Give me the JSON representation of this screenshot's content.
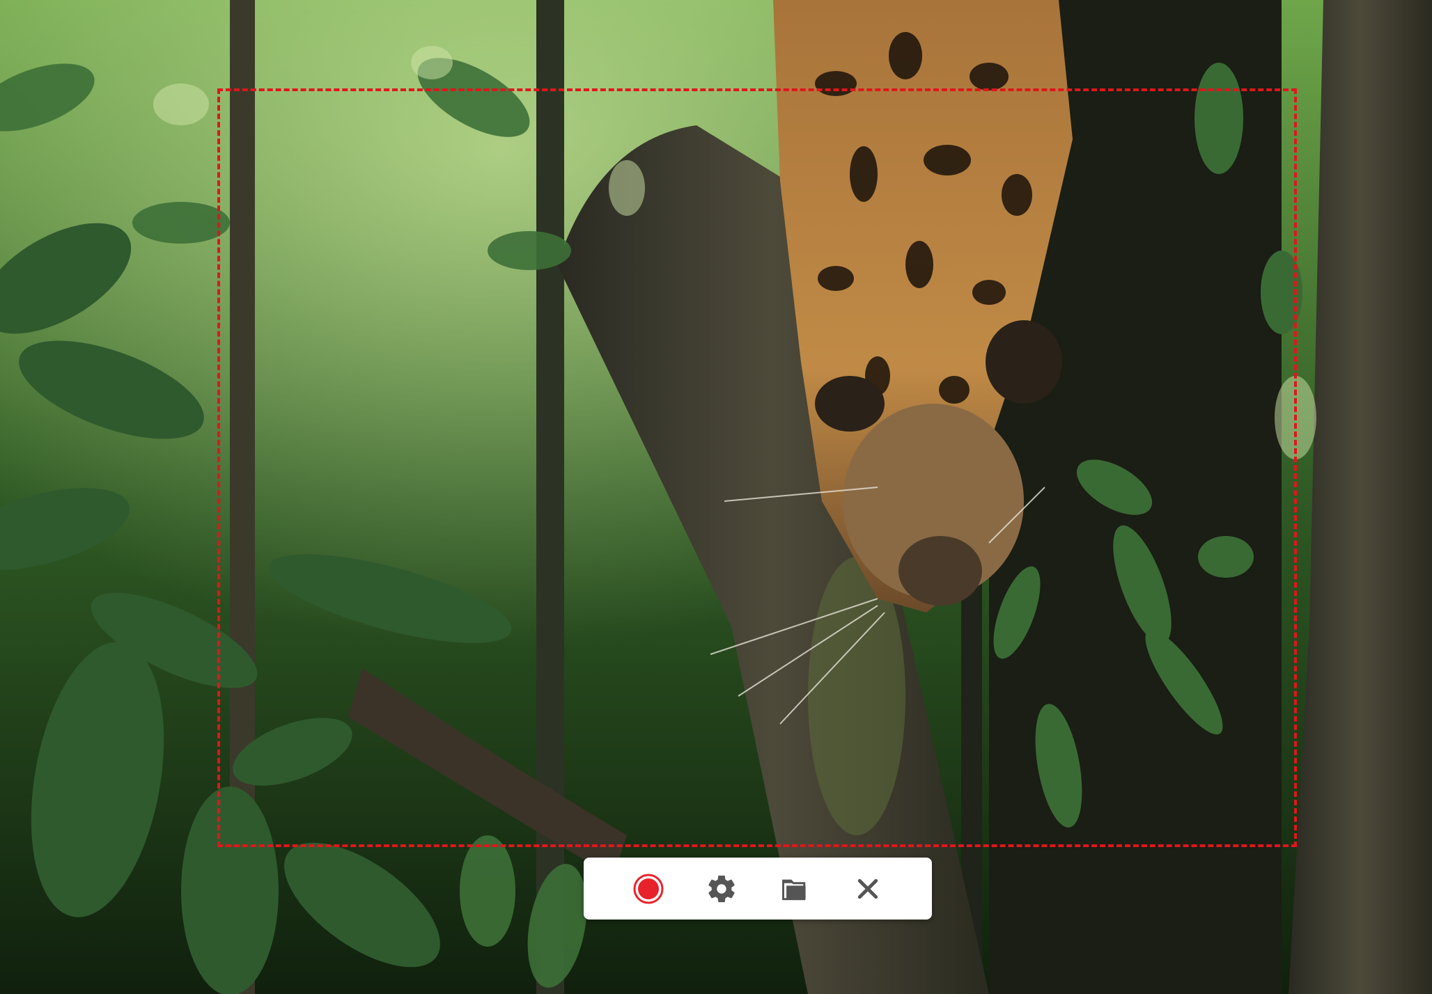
{
  "scene": {
    "description_icon": "jungle-photo-background"
  },
  "toolbar": {
    "buttons": [
      {
        "name": "record",
        "icon": "record-icon",
        "color": "#e8222a"
      },
      {
        "name": "settings",
        "icon": "gear-icon",
        "color": "#555555"
      },
      {
        "name": "open-folder",
        "icon": "folder-icon",
        "color": "#555555"
      },
      {
        "name": "close",
        "icon": "close-icon",
        "color": "#555555"
      }
    ]
  },
  "capture_region": {
    "border_color": "#e0161c"
  }
}
